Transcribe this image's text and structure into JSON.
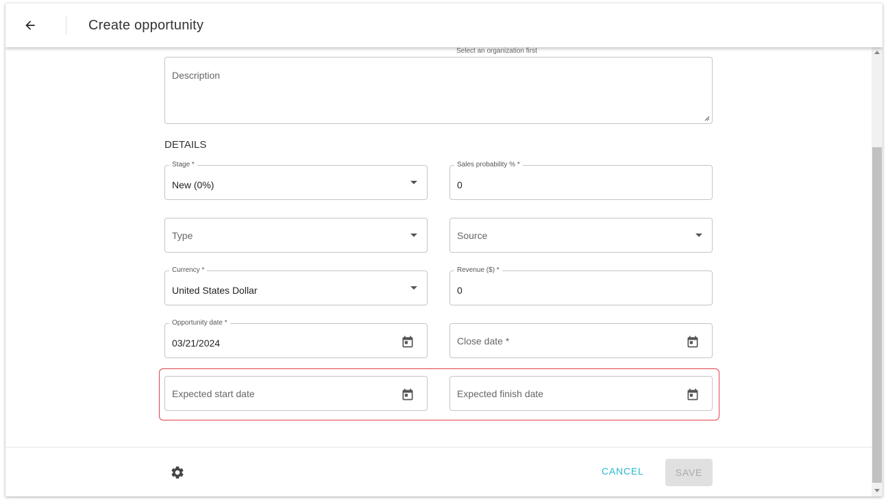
{
  "header": {
    "title": "Create opportunity",
    "back_icon": "arrow-left-icon"
  },
  "form": {
    "organization_helper": "Select an organization first",
    "description_placeholder": "Description",
    "section_title": "DETAILS",
    "stage": {
      "label": "Stage *",
      "value": "New (0%)"
    },
    "sales_probability": {
      "label": "Sales probability % *",
      "value": "0"
    },
    "type": {
      "placeholder": "Type"
    },
    "source": {
      "placeholder": "Source"
    },
    "currency": {
      "label": "Currency *",
      "value": "United States Dollar"
    },
    "revenue": {
      "label": "Revenue ($) *",
      "value": "0"
    },
    "opportunity_date": {
      "label": "Opportunity date *",
      "value": "03/21/2024"
    },
    "close_date": {
      "placeholder": "Close date *"
    },
    "expected_start_date": {
      "placeholder": "Expected start date"
    },
    "expected_finish_date": {
      "placeholder": "Expected finish date"
    }
  },
  "footer": {
    "cancel_label": "CANCEL",
    "save_label": "SAVE",
    "settings_icon": "gear-icon"
  },
  "colors": {
    "accent": "#26b8d0",
    "highlight": "#e53e4a"
  }
}
